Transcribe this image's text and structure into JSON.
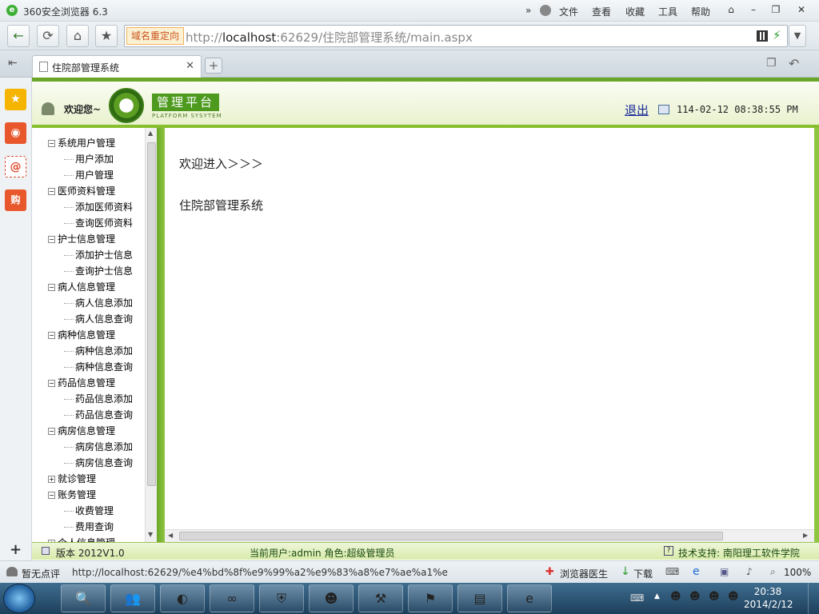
{
  "browser": {
    "title": "360安全浏览器 6.3",
    "menu": [
      "文件",
      "查看",
      "收藏",
      "工具",
      "帮助"
    ],
    "redirect_badge": "域名重定向",
    "url_prefix": "http://",
    "url_host": "localhost",
    "url_rest": ":62629/住院部管理系统/main.aspx",
    "tab_title": "住院部管理系统",
    "status_left": "暂无点评",
    "status_url": "http://localhost:62629/%e4%bd%8f%e9%99%a2%e9%83%a8%e7%ae%a1%e7%",
    "status_doctor": "浏览器医生",
    "status_download": "下载",
    "zoom": "100%"
  },
  "header": {
    "welcome": "欢迎您~",
    "platform_title": "管理平台",
    "platform_subtitle": "PLATFORM SYSYTEM",
    "logout": "退出",
    "datetime": "114-02-12 08:38:55 PM"
  },
  "tree": [
    {
      "label": "系统用户管理",
      "children": [
        "用户添加",
        "用户管理"
      ]
    },
    {
      "label": "医师资料管理",
      "children": [
        "添加医师资料",
        "查询医师资料"
      ]
    },
    {
      "label": "护士信息管理",
      "children": [
        "添加护士信息",
        "查询护士信息"
      ]
    },
    {
      "label": "病人信息管理",
      "children": [
        "病人信息添加",
        "病人信息查询"
      ]
    },
    {
      "label": "病种信息管理",
      "children": [
        "病种信息添加",
        "病种信息查询"
      ]
    },
    {
      "label": "药品信息管理",
      "children": [
        "药品信息添加",
        "药品信息查询"
      ]
    },
    {
      "label": "病房信息管理",
      "children": [
        "病房信息添加",
        "病房信息查询"
      ]
    },
    {
      "label": "就诊管理",
      "children": []
    },
    {
      "label": "账务管理",
      "children": [
        "收费管理",
        "费用查询"
      ]
    },
    {
      "label": "个人信息管理",
      "children": []
    }
  ],
  "content": {
    "welcome_enter": "欢迎进入＞＞＞",
    "system_name": "住院部管理系统"
  },
  "footer": {
    "version": "版本 2012V1.0",
    "current_user": "当前用户:admin 角色:超级管理员",
    "support": "技术支持: 南阳理工软件学院"
  },
  "taskbar": {
    "time": "20:38",
    "date": "2014/2/12"
  }
}
